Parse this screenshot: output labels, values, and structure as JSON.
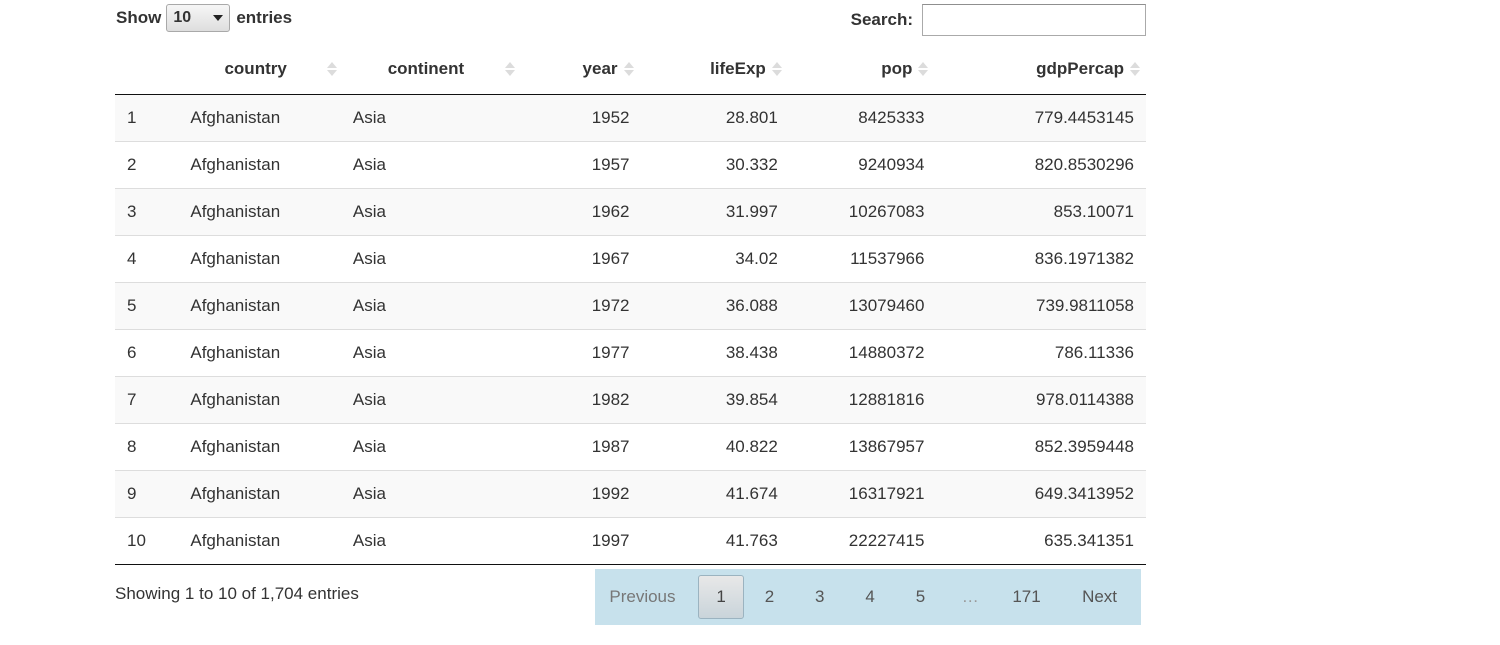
{
  "controls": {
    "show_label": "Show",
    "page_length": "10",
    "entries_label": "entries",
    "search_label": "Search:",
    "search_value": ""
  },
  "table": {
    "columns": [
      "",
      "country",
      "continent",
      "year",
      "lifeExp",
      "pop",
      "gdpPercap"
    ],
    "rows": [
      [
        "1",
        "Afghanistan",
        "Asia",
        "1952",
        "28.801",
        "8425333",
        "779.4453145"
      ],
      [
        "2",
        "Afghanistan",
        "Asia",
        "1957",
        "30.332",
        "9240934",
        "820.8530296"
      ],
      [
        "3",
        "Afghanistan",
        "Asia",
        "1962",
        "31.997",
        "10267083",
        "853.10071"
      ],
      [
        "4",
        "Afghanistan",
        "Asia",
        "1967",
        "34.02",
        "11537966",
        "836.1971382"
      ],
      [
        "5",
        "Afghanistan",
        "Asia",
        "1972",
        "36.088",
        "13079460",
        "739.9811058"
      ],
      [
        "6",
        "Afghanistan",
        "Asia",
        "1977",
        "38.438",
        "14880372",
        "786.11336"
      ],
      [
        "7",
        "Afghanistan",
        "Asia",
        "1982",
        "39.854",
        "12881816",
        "978.0114388"
      ],
      [
        "8",
        "Afghanistan",
        "Asia",
        "1987",
        "40.822",
        "13867957",
        "852.3959448"
      ],
      [
        "9",
        "Afghanistan",
        "Asia",
        "1992",
        "41.674",
        "16317921",
        "649.3413952"
      ],
      [
        "10",
        "Afghanistan",
        "Asia",
        "1997",
        "41.763",
        "22227415",
        "635.341351"
      ]
    ]
  },
  "footer": {
    "info": "Showing 1 to 10 of 1,704 entries"
  },
  "pagination": {
    "previous": "Previous",
    "pages": [
      "1",
      "2",
      "3",
      "4",
      "5"
    ],
    "ellipsis": "…",
    "last": "171",
    "next": "Next",
    "current": "1"
  },
  "colors": {
    "pager_bg": "#c7e1ec",
    "row_stripe": "#f9f9f9",
    "header_border": "#111111"
  },
  "icons": {
    "sort": "sort-both-icon",
    "select": "caret-down-icon"
  }
}
